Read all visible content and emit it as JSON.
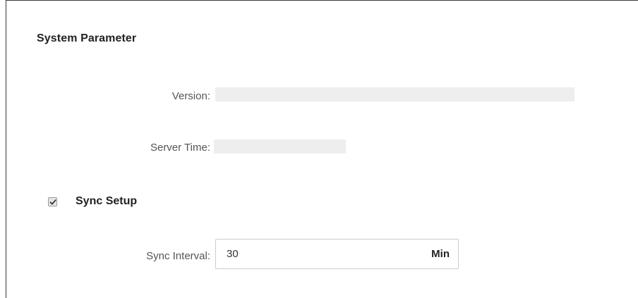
{
  "section": {
    "title": "System Parameter"
  },
  "fields": {
    "version": {
      "label": "Version:",
      "value": ""
    },
    "server_time": {
      "label": "Server Time:",
      "value": ""
    }
  },
  "sync_setup": {
    "label": "Sync Setup",
    "checked": true
  },
  "sync_interval": {
    "label": "Sync Interval:",
    "value": "30",
    "unit": "Min"
  },
  "colors": {
    "border": "#3a3a3a",
    "placeholder_bar": "#eeeeee",
    "input_border": "#cccccc"
  }
}
